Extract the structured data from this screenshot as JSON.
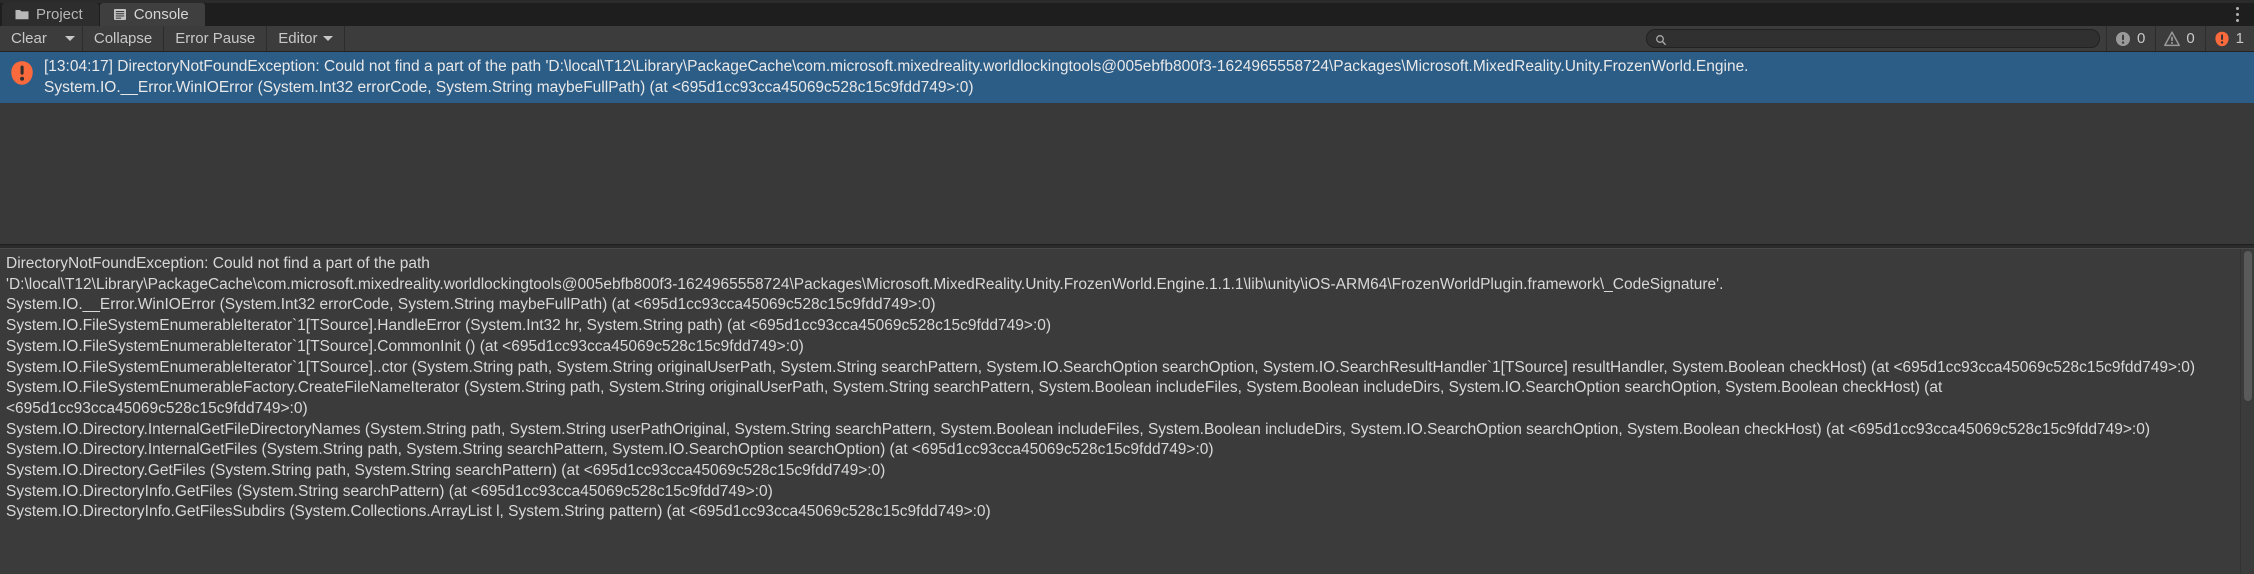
{
  "tabs": [
    {
      "label": "Project",
      "icon": "folder-icon",
      "active": false
    },
    {
      "label": "Console",
      "icon": "console-icon",
      "active": true
    }
  ],
  "toolbar": {
    "clear_label": "Clear",
    "clear_dropdown_icon": "chevron-down-icon",
    "collapse_label": "Collapse",
    "error_pause_label": "Error Pause",
    "editor_label": "Editor",
    "editor_dropdown_icon": "chevron-down-icon",
    "menu_icon": "kebab-menu-icon"
  },
  "search": {
    "value": "",
    "placeholder": "",
    "icon": "search-icon"
  },
  "counters": {
    "info": {
      "value": "0",
      "icon": "info-icon",
      "color": "#9a9a9a"
    },
    "warning": {
      "value": "0",
      "icon": "warning-icon",
      "color": "#9a9a9a"
    },
    "error": {
      "value": "1",
      "icon": "error-icon",
      "color": "#fa6a3c"
    }
  },
  "log_entries": [
    {
      "selected": true,
      "icon": "error-icon",
      "line1": "[13:04:17] DirectoryNotFoundException: Could not find a part of the path 'D:\\local\\T12\\Library\\PackageCache\\com.microsoft.mixedreality.worldlockingtools@005ebfb800f3-1624965558724\\Packages\\Microsoft.MixedReality.Unity.FrozenWorld.Engine.",
      "line2": "System.IO.__Error.WinIOError (System.Int32 errorCode, System.String maybeFullPath) (at <695d1cc93cca45069c528c15c9fdd749>:0)"
    }
  ],
  "detail": {
    "lines": [
      "DirectoryNotFoundException: Could not find a part of the path",
      "'D:\\local\\T12\\Library\\PackageCache\\com.microsoft.mixedreality.worldlockingtools@005ebfb800f3-1624965558724\\Packages\\Microsoft.MixedReality.Unity.FrozenWorld.Engine.1.1.1\\lib\\unity\\iOS-ARM64\\FrozenWorldPlugin.framework\\_CodeSignature'.",
      "System.IO.__Error.WinIOError (System.Int32 errorCode, System.String maybeFullPath) (at <695d1cc93cca45069c528c15c9fdd749>:0)",
      "System.IO.FileSystemEnumerableIterator`1[TSource].HandleError (System.Int32 hr, System.String path) (at <695d1cc93cca45069c528c15c9fdd749>:0)",
      "System.IO.FileSystemEnumerableIterator`1[TSource].CommonInit () (at <695d1cc93cca45069c528c15c9fdd749>:0)",
      "System.IO.FileSystemEnumerableIterator`1[TSource]..ctor (System.String path, System.String originalUserPath, System.String searchPattern, System.IO.SearchOption searchOption, System.IO.SearchResultHandler`1[TSource] resultHandler, System.Boolean checkHost) (at <695d1cc93cca45069c528c15c9fdd749>:0)",
      "System.IO.FileSystemEnumerableFactory.CreateFileNameIterator (System.String path, System.String originalUserPath, System.String searchPattern, System.Boolean includeFiles, System.Boolean includeDirs, System.IO.SearchOption searchOption, System.Boolean checkHost) (at <695d1cc93cca45069c528c15c9fdd749>:0)",
      "System.IO.Directory.InternalGetFileDirectoryNames (System.String path, System.String userPathOriginal, System.String searchPattern, System.Boolean includeFiles, System.Boolean includeDirs, System.IO.SearchOption searchOption, System.Boolean checkHost) (at <695d1cc93cca45069c528c15c9fdd749>:0)",
      "System.IO.Directory.InternalGetFiles (System.String path, System.String searchPattern, System.IO.SearchOption searchOption) (at <695d1cc93cca45069c528c15c9fdd749>:0)",
      "System.IO.Directory.GetFiles (System.String path, System.String searchPattern) (at <695d1cc93cca45069c528c15c9fdd749>:0)",
      "System.IO.DirectoryInfo.GetFiles (System.String searchPattern) (at <695d1cc93cca45069c528c15c9fdd749>:0)",
      "System.IO.DirectoryInfo.GetFilesSubdirs (System.Collections.ArrayList l, System.String pattern) (at <695d1cc93cca45069c528c15c9fdd749>:0)"
    ]
  }
}
